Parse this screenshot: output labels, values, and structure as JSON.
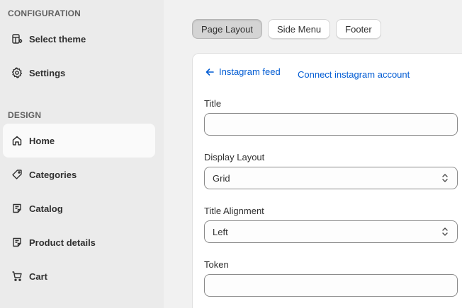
{
  "sidebar": {
    "configuration_heading": "CONFIGURATION",
    "design_heading": "DESIGN",
    "config_items": [
      {
        "label": "Select theme",
        "icon": "theme-icon"
      },
      {
        "label": "Settings",
        "icon": "gear-icon"
      }
    ],
    "design_items": [
      {
        "label": "Home",
        "icon": "home-icon",
        "active": true
      },
      {
        "label": "Categories",
        "icon": "tag-icon"
      },
      {
        "label": "Catalog",
        "icon": "note-icon"
      },
      {
        "label": "Product details",
        "icon": "note-icon"
      },
      {
        "label": "Cart",
        "icon": "cart-icon"
      }
    ]
  },
  "tabs": [
    {
      "label": "Page Layout",
      "active": true
    },
    {
      "label": "Side Menu"
    },
    {
      "label": "Footer"
    }
  ],
  "card": {
    "back_label": "Instagram feed",
    "back_icon": "arrow-left-icon",
    "connect_label": "Connect instagram account",
    "fields": {
      "title": {
        "label": "Title",
        "value": ""
      },
      "display_layout": {
        "label": "Display Layout",
        "value": "Grid"
      },
      "title_alignment": {
        "label": "Title Alignment",
        "value": "Left"
      },
      "token": {
        "label": "Token",
        "value": ""
      }
    }
  },
  "colors": {
    "link": "#005bd3",
    "sidebar_bg": "#ebebeb",
    "active_item_bg": "#fafafa"
  }
}
